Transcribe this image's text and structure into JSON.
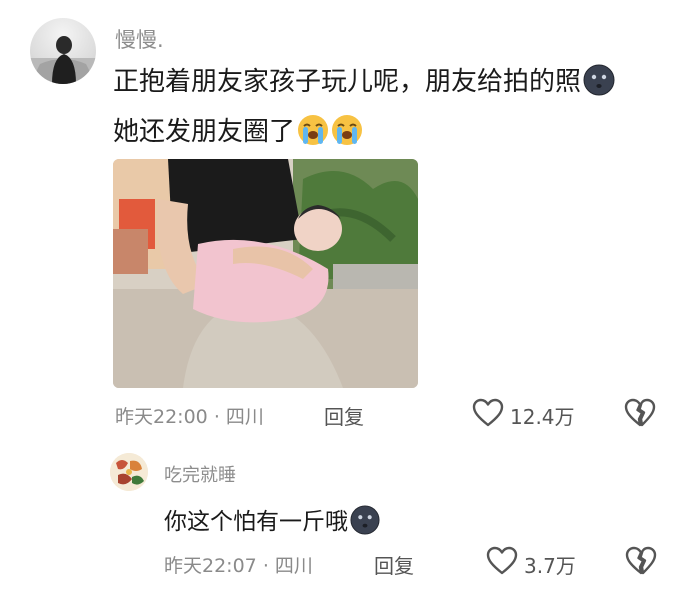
{
  "main_comment": {
    "username": "慢慢.",
    "line1": "正抱着朋友家孩子玩儿呢，朋友给拍的照",
    "line2": "她还发朋友圈了",
    "line1_emoji": "dizzy-face-emoji",
    "line2_emojis": [
      "loudly-crying-emoji",
      "loudly-crying-emoji"
    ],
    "photo": "woman-holding-baby-photo",
    "time": "昨天22:00",
    "separator": "·",
    "location": "四川",
    "reply_label": "回复",
    "like_count": "12.4万"
  },
  "reply_comment": {
    "username": "吃完就睡",
    "text": "你这个怕有一斤哦",
    "text_emoji": "dizzy-face-emoji",
    "time": "昨天22:07",
    "separator": "·",
    "location": "四川",
    "reply_label": "回复",
    "like_count": "3.7万"
  },
  "icons": {
    "like": "heart-outline-icon",
    "dislike": "broken-heart-icon"
  },
  "colors": {
    "text": "#1a1a1a",
    "muted": "#8a8a8a",
    "icon": "#555555"
  }
}
